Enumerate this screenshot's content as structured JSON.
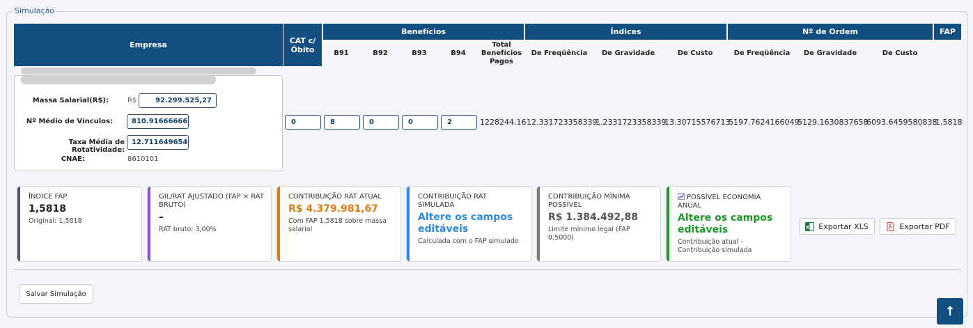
{
  "section": {
    "legend": "Simulação"
  },
  "table": {
    "headers": {
      "empresa": "Empresa",
      "cat": "CAT c/ Óbito",
      "beneficios": "Benefícios",
      "indices": "Índices",
      "ordem": "Nº de Ordem",
      "fap": "FAP"
    },
    "subheaders": {
      "b91": "B91",
      "b92": "B92",
      "b93": "B93",
      "b94": "B94",
      "total": "Total Benefícios Pagos",
      "idx_freq": "De Freqüência",
      "idx_grav": "De Gravidade",
      "idx_custo": "De Custo",
      "ord_freq": "De Freqüência",
      "ord_grav": "De Gravidade",
      "ord_custo": "De Custo"
    },
    "row": {
      "cat": "0",
      "b91": "8",
      "b92": "0",
      "b93": "0",
      "b94": "2",
      "total": "1228244.16",
      "idx_freq": "12.331723358339",
      "idx_grav": "1.2331723358339",
      "idx_custo": "13.30715576713",
      "ord_freq": "5197.7624166049",
      "ord_grav": "5129.1630837658",
      "ord_custo": "6093.6459580838",
      "fap": "1,5818"
    }
  },
  "company": {
    "massa_label": "Massa Salarial(R$):",
    "currency": "R$",
    "massa_value": "92.299.525,27",
    "vinculos_label": "Nº Médio de Vínculos:",
    "vinculos_value": "810.91666666",
    "rotatividade_label": "Taxa Média de Rotatividade:",
    "rotatividade_value": "12.711649654",
    "cnae_label": "CNAE:",
    "cnae_value": "8610101"
  },
  "cards": [
    {
      "title": "ÍNDICE FAP",
      "value": "1,5818",
      "sub": "Original: 1,5818",
      "color": "#555555"
    },
    {
      "title": "GIL/RAT AJUSTADO (FAP × RAT BRUTO)",
      "value": "–",
      "sub": "RAT bruto: 3,00%",
      "color": "#8a4fc9"
    },
    {
      "title": "CONTRIBUIÇÃO RAT ATUAL",
      "value": "R$ 4.379.981,67",
      "sub": "Com FAP 1,5818 sobre massa salarial",
      "color": "#e07b13"
    },
    {
      "title": "CONTRIBUIÇÃO RAT SIMULADA",
      "value": "Altere os campos editáveis",
      "sub": "Calculada com o FAP simulado",
      "color": "#2b8ae2"
    },
    {
      "title": "CONTRIBUIÇÃO MÍNIMA POSSÍVEL",
      "value": "R$ 1.384.492,88",
      "sub": "Limite mínimo legal (FAP 0,5000)",
      "color": "#7a7a7a"
    },
    {
      "title": "POSSÍVEL ECONOMIA ANUAL",
      "value": "Altere os campos editáveis",
      "sub": "Contribuição atual - Contribuição simulada",
      "color": "#1c9b2a"
    }
  ],
  "buttons": {
    "export_xls": "Exportar XLS",
    "export_pdf": "Exportar PDF",
    "save": "Salvar Simulação",
    "top": "↑"
  }
}
